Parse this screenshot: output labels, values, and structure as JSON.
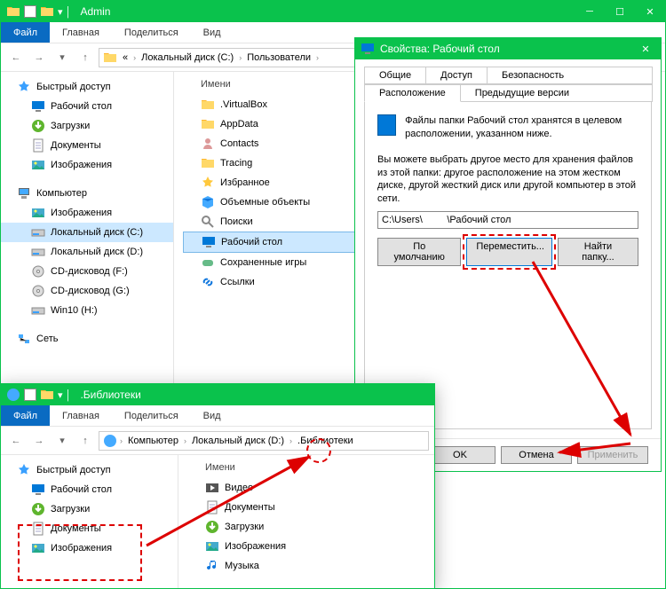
{
  "win1": {
    "title": "Admin",
    "ribbon": {
      "file": "Файл",
      "home": "Главная",
      "share": "Поделиться",
      "view": "Вид"
    },
    "breadcrumb": {
      "b1": "«",
      "b2": "Локальный диск (C:)",
      "b3": "Пользователи"
    },
    "qa": {
      "head": "Быстрый доступ",
      "desktop": "Рабочий стол",
      "downloads": "Загрузки",
      "documents": "Документы",
      "pictures": "Изображения"
    },
    "pc": {
      "head": "Компьютер",
      "pictures": "Изображения",
      "c": "Локальный диск (C:)",
      "d": "Локальный диск (D:)",
      "f": "CD-дисковод (F:)",
      "g": "CD-дисковод (G:)",
      "h": "Win10 (H:)"
    },
    "net": "Сеть",
    "contentHead": "Имени",
    "items": {
      "vbox": ".VirtualBox",
      "appdata": "AppData",
      "contacts": "Contacts",
      "tracing": "Tracing",
      "fav": "Избранное",
      "vol": "Объемные объекты",
      "search": "Поиски",
      "desk": "Рабочий стол",
      "saved": "Сохраненные игры",
      "links": "Ссылки"
    }
  },
  "dlg": {
    "title": "Свойства: Рабочий стол",
    "tabs": {
      "general": "Общие",
      "access": "Доступ",
      "security": "Безопасность",
      "location": "Расположение",
      "prev": "Предыдущие версии"
    },
    "desc1": "Файлы папки Рабочий стол хранятся в целевом расположении, указанном ниже.",
    "desc2": "Вы можете выбрать другое место для хранения файлов из этой папки: другое расположение на этом жестком диске, другой жесткий диск или другой компьютер в этой сети.",
    "path": "C:\\Users\\         \\Рабочий стол",
    "btns": {
      "default": "По умолчанию",
      "move": "Переместить...",
      "find": "Найти папку..."
    },
    "footer": {
      "ok": "OK",
      "cancel": "Отмена",
      "apply": "Применить"
    }
  },
  "win2": {
    "title": ".Библиотеки",
    "ribbon": {
      "file": "Файл",
      "home": "Главная",
      "share": "Поделиться",
      "view": "Вид"
    },
    "breadcrumb": {
      "b1": "Компьютер",
      "b2": "Локальный диск (D:)",
      "b3": ".Библиотеки"
    },
    "qa": {
      "head": "Быстрый доступ",
      "desktop": "Рабочий стол",
      "downloads": "Загрузки",
      "documents": "Документы",
      "pictures": "Изображения"
    },
    "contentHead": "Имени",
    "items": {
      "video": "Видео",
      "docs": "Документы",
      "dl": "Загрузки",
      "pics": "Изображения",
      "music": "Музыка"
    }
  }
}
